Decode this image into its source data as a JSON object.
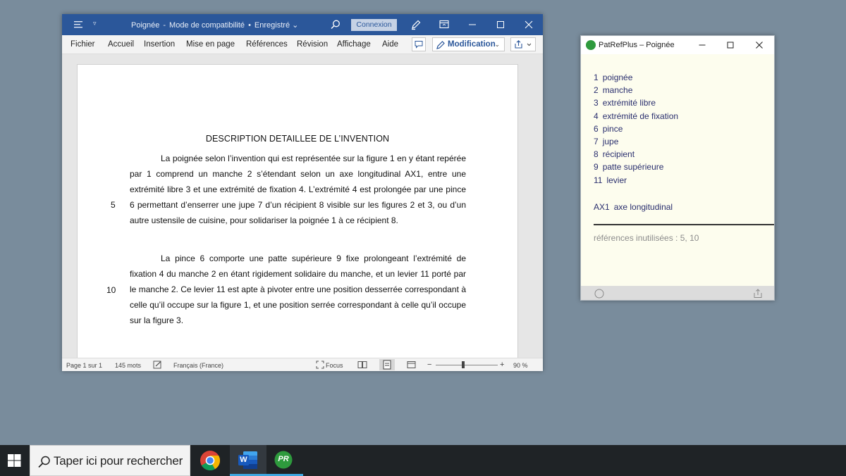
{
  "word": {
    "title": {
      "doc": "Poignée",
      "mode": "Mode de compatibilité",
      "saved": "Enregistré"
    },
    "connexion": "Connexion",
    "menu": [
      "Fichier",
      "Accueil",
      "Insertion",
      "Mise en page",
      "Références",
      "Révision",
      "Affichage",
      "Aide"
    ],
    "modification": "Modification",
    "document": {
      "heading": "DESCRIPTION DETAILLEE DE L’INVENTION",
      "paragraphs": [
        "La poignée selon l’invention qui est représentée sur la figure 1 en y étant repérée par 1 comprend un manche 2 s’étendant selon un axe longitudinal AX1, entre une extrémité libre 3 et une extrémité de fixation 4. L’extrémité 4 est prolongée par une pince 6 permettant d’enserrer une jupe 7 d’un récipient 8 visible sur les figures 2 et 3, ou d’un autre ustensile de cuisine, pour solidariser la poignée 1 à ce récipient 8.",
        "La pince 6 comporte une patte supérieure 9 fixe prolongeant l’extrémité de fixation 4 du manche 2 en étant rigidement solidaire du manche, et un levier 11 porté par le manche 2. Ce levier 11 est apte à pivoter entre une position desserrée correspondant à celle qu’il occupe sur la figure 1, et une position serrée correspondant à celle qu’il occupe sur la figure 3."
      ],
      "line_numbers": [
        "5",
        "10"
      ]
    },
    "status": {
      "page": "Page 1 sur 1",
      "words": "145 mots",
      "language": "Français (France)",
      "focus": "Focus",
      "zoom_minus": "−",
      "zoom_plus": "+",
      "zoom": "90 %",
      "zoom_level_percent": 90
    }
  },
  "patref": {
    "title": "PatRefPlus – Poignée",
    "references": [
      {
        "num": "1",
        "label": "poignée"
      },
      {
        "num": "2",
        "label": "manche"
      },
      {
        "num": "3",
        "label": "extrémité libre"
      },
      {
        "num": "4",
        "label": "extrémité de fixation"
      },
      {
        "num": "6",
        "label": "pince"
      },
      {
        "num": "7",
        "label": "jupe"
      },
      {
        "num": "8",
        "label": "récipient"
      },
      {
        "num": "9",
        "label": "patte supérieure"
      },
      {
        "num": "11",
        "label": "levier"
      }
    ],
    "axis": {
      "num": "AX1",
      "label": "axe longitudinal"
    },
    "unused": "références inutilisées : 5, 10"
  },
  "taskbar": {
    "search_placeholder": "Taper ici pour rechercher",
    "apps": [
      "chrome-icon",
      "word-icon",
      "patrefplus-icon"
    ],
    "word_badge": "W",
    "patref_badge": "PR"
  },
  "colors": {
    "word_blue": "#2b579a",
    "patref_bg": "#fdfdee",
    "patref_green": "#2e9a3d",
    "desktop": "#798c9c",
    "taskbar": "#1f2326",
    "accent": "#3ea7e0"
  }
}
